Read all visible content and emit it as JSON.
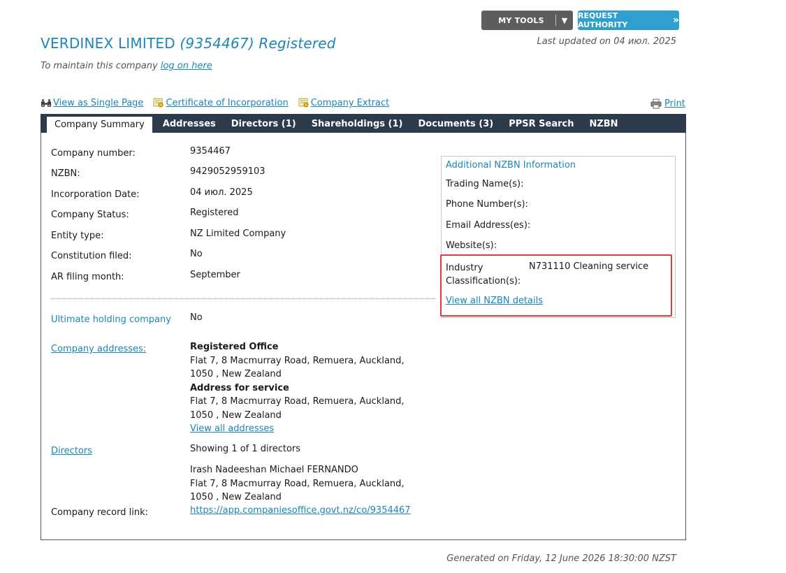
{
  "header": {
    "my_tools": "MY TOOLS",
    "my_tools_caret": "▼",
    "request_authority": "REQUEST AUTHORITY",
    "request_authority_arrow": "»",
    "last_updated": "Last updated on 04 июл. 2025"
  },
  "company": {
    "name": "VERDINEX LIMITED",
    "number_in_title": "(9354467) Registered",
    "maintain_prefix": "To maintain this company",
    "maintain_link": "log on here"
  },
  "quick_links": {
    "single_page": "View as Single Page",
    "certificate": "Certificate of Incorporation",
    "extract": "Company Extract",
    "print": "Print"
  },
  "tabs": [
    {
      "label": "Company Summary"
    },
    {
      "label": "Addresses"
    },
    {
      "label": "Directors (1)"
    },
    {
      "label": "Shareholdings (1)"
    },
    {
      "label": "Documents (3)"
    },
    {
      "label": "PPSR Search"
    },
    {
      "label": "NZBN"
    }
  ],
  "summary": {
    "company_number_label": "Company number:",
    "company_number": "9354467",
    "nzbn_label": "NZBN:",
    "nzbn": "9429052959103",
    "incorporation_label": "Incorporation Date:",
    "incorporation": "04 июл. 2025",
    "status_label": "Company Status:",
    "status": "Registered",
    "entity_label": "Entity type:",
    "entity": "NZ Limited Company",
    "constitution_label": "Constitution filed:",
    "constitution": "No",
    "ar_label": "AR filing month:",
    "ar": "September",
    "ultimate_label": "Ultimate holding company",
    "ultimate": "No",
    "addresses_label": "Company addresses:",
    "registered_office_heading": "Registered Office",
    "registered_office_line1": "Flat 7, 8 Macmurray Road, Remuera, Auckland,",
    "registered_office_line2": "1050 , New Zealand",
    "service_heading": "Address for service",
    "service_line1": "Flat 7, 8 Macmurray Road, Remuera, Auckland,",
    "service_line2": "1050 , New Zealand",
    "view_all_addresses": "View all addresses",
    "directors_label": "Directors",
    "directors_showing": "Showing 1 of 1 directors",
    "director_name": "Irash Nadeeshan Michael FERNANDO",
    "director_line1": "Flat 7, 8 Macmurray Road, Remuera, Auckland,",
    "director_line2": "1050 , New Zealand",
    "record_link_label": "Company record link:",
    "record_link": "https://app.companiesoffice.govt.nz/co/9354467"
  },
  "nzbn_info": {
    "title": "Additional NZBN Information",
    "trading_names": "Trading Name(s):",
    "phone": "Phone Number(s):",
    "email": "Email Address(es):",
    "website": "Website(s):",
    "industry_line1": "Industry",
    "industry_line2": "Classification(s):",
    "industry_value": "N731110 Cleaning service",
    "view_all": "View all NZBN details"
  },
  "footer": {
    "generated": "Generated on Friday, 12 June 2026 18:30:00 NZST"
  },
  "colors": {
    "link": "#1b86b8",
    "tabbar": "#2b3b4b",
    "request_button": "#2f9fce",
    "tools_button": "#5d5d5d",
    "highlight": "#e23a3a"
  }
}
